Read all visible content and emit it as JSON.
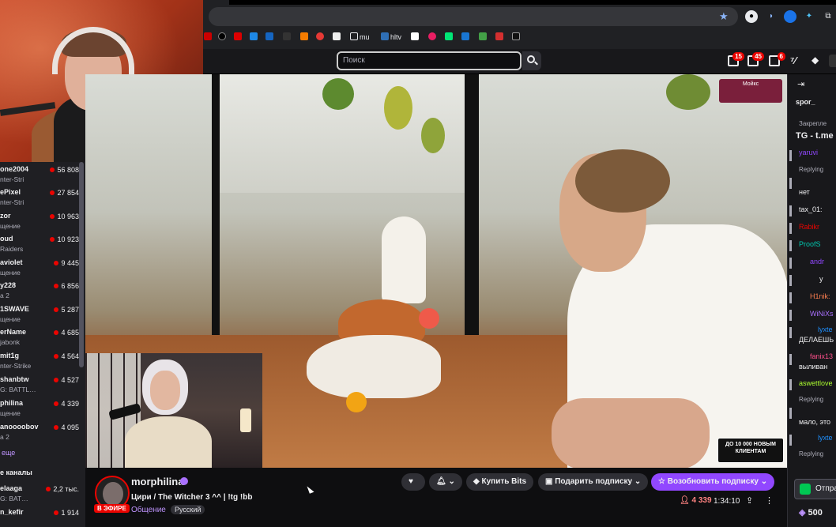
{
  "browser": {
    "bookmarks": [
      "mu",
      "hltv"
    ]
  },
  "nav": {
    "search_placeholder": "Поиск",
    "badges": {
      "inbox": "15",
      "whispers": "45",
      "notifications": "6"
    }
  },
  "sidebar": {
    "channels": [
      {
        "name": "one2004",
        "game": "nter-Stri",
        "viewers": "56 808"
      },
      {
        "name": "ePixel",
        "game": "nter-Stri",
        "viewers": "27 854"
      },
      {
        "name": "zor",
        "game": "щение",
        "viewers": "10 963"
      },
      {
        "name": "oud",
        "game": "Raiders",
        "viewers": "10 923"
      },
      {
        "name": "aviolet",
        "game": "щение",
        "viewers": "9 445"
      },
      {
        "name": "y228",
        "game": "а 2",
        "viewers": "6 856"
      },
      {
        "name": "1SWAVE",
        "game": "щение",
        "viewers": "5 287"
      },
      {
        "name": "erName",
        "game": "jabonk",
        "viewers": "4 685"
      },
      {
        "name": "mit1g",
        "game": "nter-Strike",
        "viewers": "4 564"
      },
      {
        "name": "shanbtw",
        "game": "G: BATTL…",
        "viewers": "4 527"
      },
      {
        "name": "philina",
        "game": "щение",
        "viewers": "4 339"
      },
      {
        "name": "anoooobov",
        "game": "а 2",
        "viewers": "4 095"
      }
    ],
    "show_more": "еще",
    "section2": "е каналы",
    "channels2": [
      {
        "name": "elaaga",
        "game": "G: BAT…",
        "viewers": "2,2 тыс."
      },
      {
        "name": "n_kefir",
        "game": "",
        "viewers": "1 914"
      }
    ]
  },
  "video": {
    "promo_top": "Мойкс",
    "promo_bottom": "ДО 10 000 НОВЫМ КЛИЕНТАМ"
  },
  "channel": {
    "name": "morphilina",
    "title": "Цири / The Witcher 3 ^^ | !tg !bb",
    "live": "В ЭФИРЕ",
    "category": "Общение",
    "language": "Русский",
    "viewers": "4 339",
    "uptime": "1:34:10",
    "buttons": {
      "bits": "Купить Bits",
      "gift": "Подарить подписку",
      "resub": "Возобновить подписку"
    }
  },
  "chat": {
    "header": "spor_",
    "pinned_label": "Закрепле",
    "pinned_text": "TG - t.me",
    "lines": [
      {
        "text": "yaruvi",
        "color": "#9147ff"
      },
      {
        "text": "Replying",
        "color": "#adadb8"
      },
      {
        "text": "нет",
        "color": "#efeff1"
      },
      {
        "text": "tax_01:",
        "color": "#efeff1"
      },
      {
        "text": "Rabikr",
        "color": "#eb0400"
      },
      {
        "text": "ProofS",
        "color": "#00c8af"
      },
      {
        "text": "andr",
        "color": "#9147ff"
      },
      {
        "text": "у",
        "color": "#efeff1"
      },
      {
        "text": "H1nik:",
        "color": "#ff7f50"
      },
      {
        "text": "WiNiXs",
        "color": "#a970ff"
      },
      {
        "text": "lyxte",
        "color": "#1e90ff"
      },
      {
        "text": "ДЕЛАЕШЬ",
        "color": "#efeff1"
      },
      {
        "text": "fanix13",
        "color": "#ff4f8b"
      },
      {
        "text": "выливан",
        "color": "#efeff1"
      },
      {
        "text": "aswettlove",
        "color": "#adff2f"
      },
      {
        "text": "Replying",
        "color": "#adadb8"
      },
      {
        "text": "мало, это",
        "color": "#efeff1"
      },
      {
        "text": "lyxte",
        "color": "#1e90ff"
      },
      {
        "text": "Replying",
        "color": "#adadb8"
      }
    ],
    "send_button": "Отпра",
    "points": "500"
  }
}
